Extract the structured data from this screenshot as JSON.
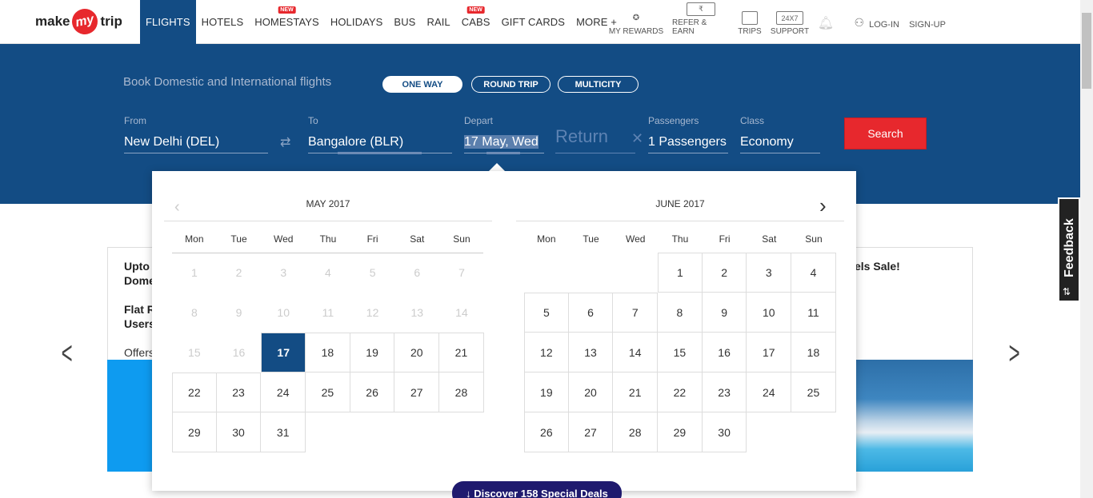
{
  "brand": {
    "left": "make",
    "mid": "my",
    "right": "trip"
  },
  "nav": [
    {
      "label": "FLIGHTS",
      "active": true
    },
    {
      "label": "HOTELS"
    },
    {
      "label": "HOMESTAYS",
      "badge": "NEW"
    },
    {
      "label": "HOLIDAYS"
    },
    {
      "label": "BUS"
    },
    {
      "label": "RAIL"
    },
    {
      "label": "CABS",
      "badge": "NEW"
    },
    {
      "label": "GIFT CARDS"
    },
    {
      "label": "MORE +"
    }
  ],
  "right_nav": {
    "rewards": "MY REWARDS",
    "refer": "REFER & EARN",
    "trips": "TRIPS",
    "support_box": "24X7",
    "support": "SUPPORT",
    "login": "LOG-IN",
    "signup": "SIGN-UP"
  },
  "search": {
    "title": "Book Domestic and International flights",
    "trip_types": [
      "ONE WAY",
      "ROUND TRIP",
      "MULTICITY"
    ],
    "from_label": "From",
    "from_value": "New Delhi (DEL)",
    "to_label": "To",
    "to_value": "Bangalore (BLR)",
    "depart_label": "Depart",
    "depart_value": "17 May, Wed",
    "return_placeholder": "Return",
    "passengers_label": "Passengers",
    "passengers_value": "1 Passengers",
    "class_label": "Class",
    "class_value": "Economy",
    "button": "Search"
  },
  "calendar": {
    "weekdays": [
      "Mon",
      "Tue",
      "Wed",
      "Thu",
      "Fri",
      "Sat",
      "Sun"
    ],
    "months": [
      {
        "title": "MAY 2017",
        "offset": 0,
        "days": 31,
        "disabled_until": 16,
        "selected": 17
      },
      {
        "title": "JUNE 2017",
        "offset": 3,
        "days": 30,
        "disabled_until": 0,
        "selected": null
      }
    ]
  },
  "promo": {
    "line1a": "Upto",
    "line1b": "Dome",
    "line2a": "Flat R",
    "line2b": "Users",
    "offers": "Offers",
    "right": "els Sale!"
  },
  "feedback": "Feedback",
  "deals": "↓ Discover 158 Special Deals"
}
